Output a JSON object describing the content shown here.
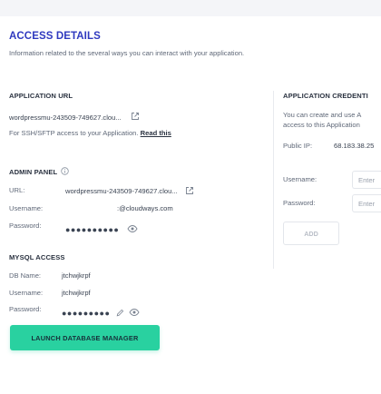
{
  "section": {
    "title": "ACCESS DETAILS",
    "subtitle": "Information related to the several ways you can interact with your application."
  },
  "app_url": {
    "heading": "APPLICATION URL",
    "url": "wordpressmu-243509-749627.clou...",
    "ssh_note": "For SSH/SFTP access to your Application.",
    "read_this": "Read this"
  },
  "admin_panel": {
    "heading": "ADMIN PANEL",
    "url_label": "URL:",
    "url_value": "wordpressmu-243509-749627.clou...",
    "username_label": "Username:",
    "username_value": ":@cloudways.com",
    "password_label": "Password:",
    "password_mask": "●●●●●●●●●●"
  },
  "mysql": {
    "heading": "MYSQL ACCESS",
    "db_label": "DB Name:",
    "db_value": "jtchwjkrpf",
    "username_label": "Username:",
    "username_value": "jtchwjkrpf",
    "password_label": "Password:",
    "password_mask": "●●●●●●●●●"
  },
  "launch_button": "LAUNCH DATABASE MANAGER",
  "credentials": {
    "heading": "APPLICATION CREDENTI",
    "desc_line1": "You can create and use A",
    "desc_line2": "access to this Application",
    "public_ip_label": "Public IP:",
    "public_ip_value": "68.183.38.25",
    "username_label": "Username:",
    "username_placeholder": "Enter",
    "password_label": "Password:",
    "password_placeholder": "Enter",
    "add_button": "ADD"
  },
  "colors": {
    "accent": "#2f39bf",
    "button_green": "#29d1a0"
  },
  "icons": [
    "external-link-icon",
    "info-icon",
    "eye-icon",
    "pencil-icon"
  ]
}
